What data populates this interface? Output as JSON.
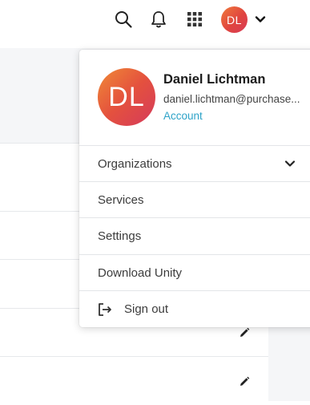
{
  "topbar": {
    "icons": [
      "search-icon",
      "bell-icon",
      "apps-grid-icon"
    ],
    "avatar_initials": "DL"
  },
  "user": {
    "initials": "DL",
    "name": "Daniel Lichtman",
    "email": "daniel.lichtman@purchase...",
    "account_label": "Account"
  },
  "menu": {
    "organizations": "Organizations",
    "services": "Services",
    "settings": "Settings",
    "download_unity": "Download Unity",
    "sign_out": "Sign out"
  },
  "colors": {
    "accent_link": "#2ea3c8",
    "avatar_gradient_start": "#f08a36",
    "avatar_gradient_end": "#d53a5c"
  }
}
